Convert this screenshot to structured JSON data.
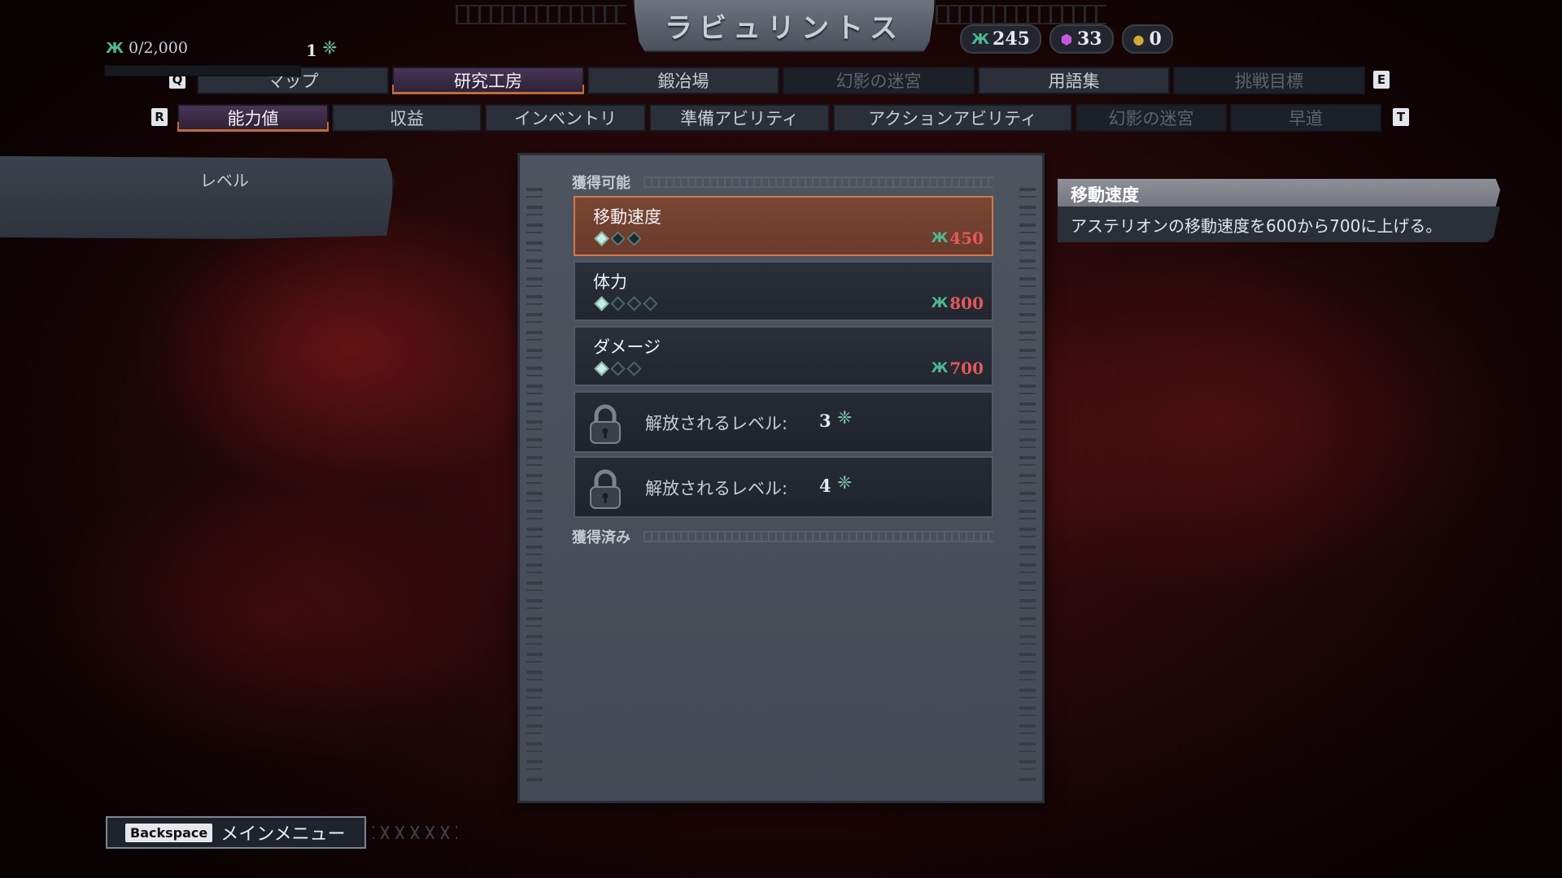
{
  "title": "ラビュリントス",
  "currencies": [
    {
      "icon": "bone-currency-icon",
      "value": "245"
    },
    {
      "icon": "gem-icon",
      "value": "33"
    },
    {
      "icon": "coin-icon",
      "value": "0"
    }
  ],
  "main_tabs": {
    "key_left": "Q",
    "key_right": "E",
    "items": [
      {
        "label": "マップ",
        "state": "normal"
      },
      {
        "label": "研究工房",
        "state": "active"
      },
      {
        "label": "鍛冶場",
        "state": "normal"
      },
      {
        "label": "幻影の迷宮",
        "state": "dim"
      },
      {
        "label": "用語集",
        "state": "normal"
      },
      {
        "label": "挑戦目標",
        "state": "dim"
      }
    ]
  },
  "sub_tabs": {
    "key_left": "R",
    "key_right": "T",
    "items": [
      {
        "label": "能力値",
        "state": "active"
      },
      {
        "label": "収益",
        "state": "normal"
      },
      {
        "label": "インベントリ",
        "state": "normal"
      },
      {
        "label": "準備アビリティ",
        "state": "normal"
      },
      {
        "label": "アクションアビリティ",
        "state": "normal"
      },
      {
        "label": "幻影の迷宮",
        "state": "dim"
      },
      {
        "label": "早道",
        "state": "dim"
      }
    ]
  },
  "level": {
    "label": "レベル",
    "xp": "0/2,000",
    "progress": 0,
    "value": "1"
  },
  "sections": {
    "available": "獲得可能",
    "acquired": "獲得済み"
  },
  "upgrades": [
    {
      "name": "移動速度",
      "pips_total": 3,
      "pips_filled": 1,
      "cost": "450",
      "selected": true
    },
    {
      "name": "体力",
      "pips_total": 4,
      "pips_filled": 1,
      "cost": "800",
      "selected": false
    },
    {
      "name": "ダメージ",
      "pips_total": 3,
      "pips_filled": 1,
      "cost": "700",
      "selected": false
    }
  ],
  "locked": [
    {
      "text": "解放されるレベル:",
      "level": "3"
    },
    {
      "text": "解放されるレベル:",
      "level": "4"
    }
  ],
  "tooltip": {
    "title": "移動速度",
    "description": "アステリオンの移動速度を600から700に上げる。"
  },
  "back": {
    "key": "Backspace",
    "label": "メインメニュー"
  },
  "colors": {
    "accent_orange": "#d07a4a",
    "cost_red": "#e2585a",
    "bone_green": "#4fb892",
    "active_tab": "#4a3457"
  }
}
